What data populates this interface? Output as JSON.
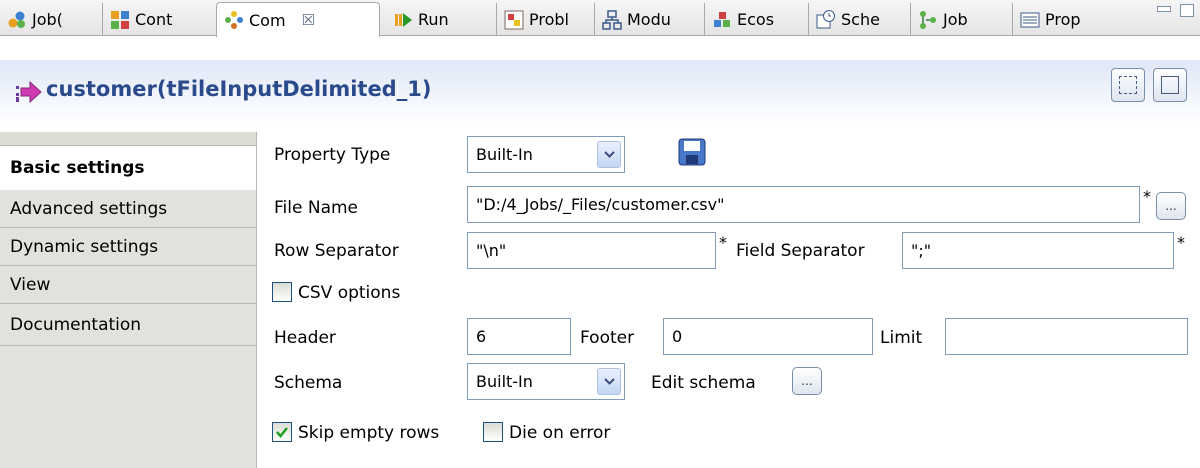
{
  "tabs": [
    {
      "label": "Job(",
      "icon": "job-icon"
    },
    {
      "label": "Cont",
      "icon": "context-icon"
    },
    {
      "label": "Com",
      "icon": "component-icon",
      "active": true,
      "close": "☒"
    },
    {
      "label": "Run",
      "icon": "run-icon"
    },
    {
      "label": "Probl",
      "icon": "problems-icon"
    },
    {
      "label": "Modu",
      "icon": "modules-icon"
    },
    {
      "label": "Ecos",
      "icon": "ecosystem-icon"
    },
    {
      "label": "Sche",
      "icon": "scheduler-icon"
    },
    {
      "label": "Job",
      "icon": "jobs-icon"
    },
    {
      "label": "Prop",
      "icon": "properties-icon"
    }
  ],
  "component": {
    "title": "customer(tFileInputDelimited_1)"
  },
  "nav": {
    "items": [
      "Basic settings",
      "Advanced settings",
      "Dynamic settings",
      "View",
      "Documentation"
    ],
    "selected": "Basic settings"
  },
  "form": {
    "property_type_label": "Property Type",
    "property_type_value": "Built-In",
    "file_name_label": "File Name",
    "file_name_value": "\"D:/4_Jobs/_Files/customer.csv\"",
    "row_separator_label": "Row Separator",
    "row_separator_value": "\"\\n\"",
    "field_separator_label": "Field Separator",
    "field_separator_value": "\";\"",
    "required_mark": "*",
    "csv_options_label": "CSV options",
    "csv_options_checked": false,
    "header_label": "Header",
    "header_value": "6",
    "footer_label": "Footer",
    "footer_value": "0",
    "limit_label": "Limit",
    "limit_value": "",
    "schema_label": "Schema",
    "schema_value": "Built-In",
    "edit_schema_label": "Edit schema",
    "browse_button": "...",
    "skip_empty_rows_label": "Skip empty rows",
    "skip_empty_rows_checked": true,
    "die_on_error_label": "Die on error",
    "die_on_error_checked": false
  },
  "colors": {
    "title": "#2b4a8b",
    "nav_bg": "#e2e2dc",
    "field_border": "#7f9db9",
    "check_mark": "#21a121"
  }
}
